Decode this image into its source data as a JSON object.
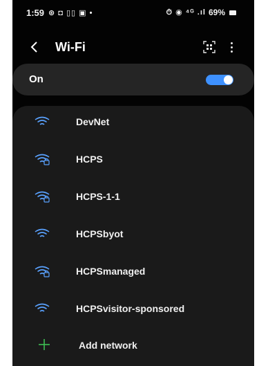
{
  "status_bar": {
    "time": "1:59",
    "left_icons": "⊛ ◘ ▯▯ ▣ •",
    "right_icons": "⏱ ◉ ⁴ᴳ .ıl",
    "battery": "69%"
  },
  "header": {
    "back_icon": "back-arrow-icon",
    "title": "Wi-Fi",
    "qr_icon": "qr-scan-icon",
    "more_icon": "more-vertical-icon"
  },
  "wifi_toggle": {
    "label": "On",
    "state": "on",
    "accent_color": "#3e91ff"
  },
  "networks": [
    {
      "name": "DevNet",
      "secured": false
    },
    {
      "name": "HCPS",
      "secured": true
    },
    {
      "name": "HCPS-1-1",
      "secured": true
    },
    {
      "name": "HCPSbyot",
      "secured": false
    },
    {
      "name": "HCPSmanaged",
      "secured": true
    },
    {
      "name": "HCPSvisitor-sponsored",
      "secured": false
    }
  ],
  "add_network": {
    "label": "Add network",
    "icon": "plus-icon",
    "icon_color": "#3dbe53"
  },
  "background_glyph": "r"
}
